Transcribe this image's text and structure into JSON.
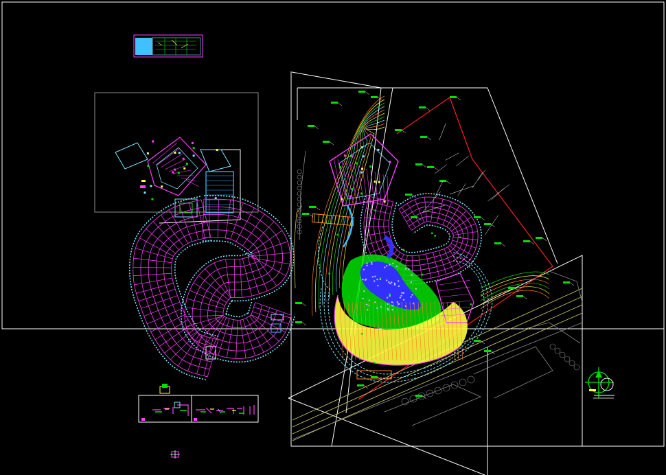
{
  "drawing": {
    "background": "#000000",
    "palette": {
      "frame": "#ffffff",
      "grey": "#8c8c8c",
      "magenta": "#ff40ff",
      "cyan": "#7fe6ff",
      "green": "#00e000",
      "yellow": "#ffff40",
      "orange": "#ff8020",
      "red": "#ff2020",
      "blue": "#3030ff",
      "light_blue": "#40c0ff",
      "white": "#ffffff",
      "olive": "#c8c860"
    }
  }
}
